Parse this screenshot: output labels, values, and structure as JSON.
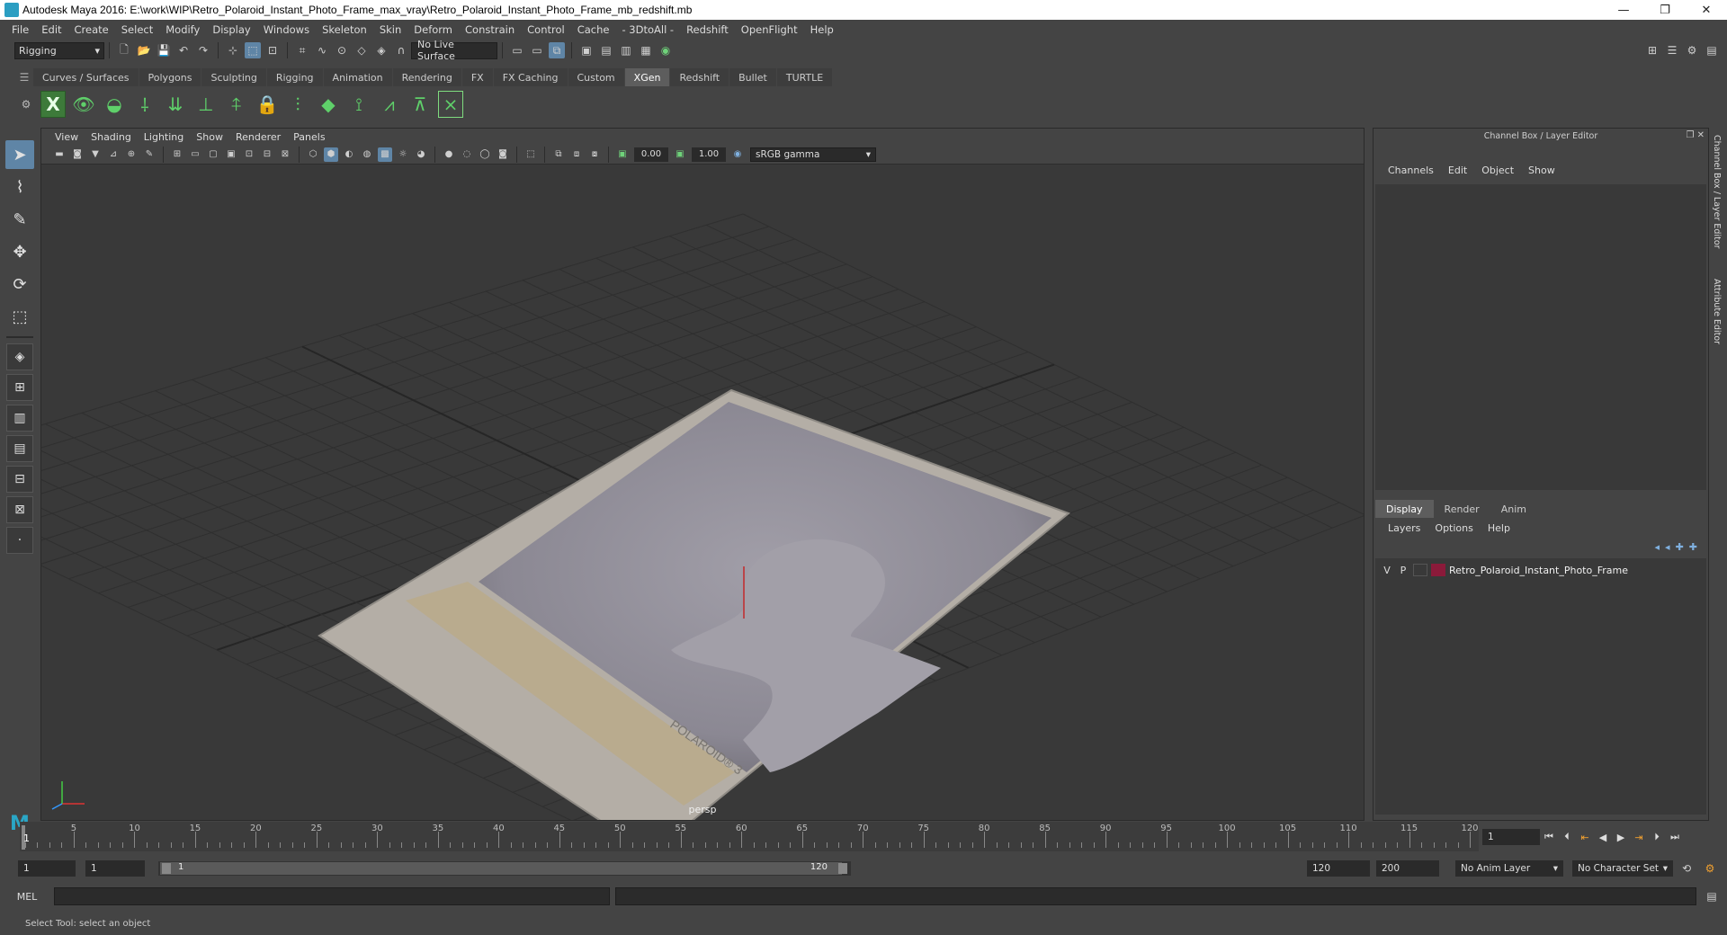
{
  "window": {
    "title": "Autodesk Maya 2016: E:\\work\\WIP\\Retro_Polaroid_Instant_Photo_Frame_max_vray\\Retro_Polaroid_Instant_Photo_Frame_mb_redshift.mb",
    "minimize": "—",
    "maximize": "❐",
    "close": "✕"
  },
  "menus": [
    "File",
    "Edit",
    "Create",
    "Select",
    "Modify",
    "Display",
    "Windows",
    "Skeleton",
    "Skin",
    "Deform",
    "Constrain",
    "Control",
    "Cache",
    "- 3DtoAll -",
    "Redshift",
    "OpenFlight",
    "Help"
  ],
  "status_line": {
    "mode": "Rigging",
    "live_surface": "No Live Surface"
  },
  "shelf_tabs": [
    "Curves / Surfaces",
    "Polygons",
    "Sculpting",
    "Rigging",
    "Animation",
    "Rendering",
    "FX",
    "FX Caching",
    "Custom",
    "XGen",
    "Redshift",
    "Bullet",
    "TURTLE"
  ],
  "active_shelf_tab": "XGen",
  "viewport": {
    "menus": [
      "View",
      "Shading",
      "Lighting",
      "Show",
      "Renderer",
      "Panels"
    ],
    "exposure": "0.00",
    "gamma": "1.00",
    "color_space": "sRGB gamma",
    "camera_label": "persp",
    "photo_brand_text": "POLAROID® 3"
  },
  "channel_box": {
    "title": "Channel Box / Layer Editor",
    "menus": [
      "Channels",
      "Edit",
      "Object",
      "Show"
    ],
    "layer_tabs": [
      "Display",
      "Render",
      "Anim"
    ],
    "active_layer_tab": "Display",
    "layer_menus": [
      "Layers",
      "Options",
      "Help"
    ],
    "layers": [
      {
        "visible": "V",
        "playback": "P",
        "color": "#8b1a3a",
        "name": "Retro_Polaroid_Instant_Photo_Frame"
      }
    ],
    "side_tabs": [
      "Channel Box / Layer Editor",
      "Attribute Editor"
    ]
  },
  "time_slider": {
    "ticks": [
      "5",
      "10",
      "15",
      "20",
      "25",
      "30",
      "35",
      "40",
      "45",
      "50",
      "55",
      "60",
      "65",
      "70",
      "75",
      "80",
      "85",
      "90",
      "95",
      "100",
      "105",
      "110",
      "115",
      "120"
    ],
    "current_frame": "1",
    "current_frame_field": "1"
  },
  "range": {
    "start": "1",
    "playback_start": "1",
    "slider_start": "1",
    "slider_end": "120",
    "playback_end": "120",
    "end": "200",
    "anim_layer": "No Anim Layer",
    "character_set": "No Character Set"
  },
  "command_line": {
    "label": "MEL"
  },
  "help_line": "Select Tool: select an object"
}
